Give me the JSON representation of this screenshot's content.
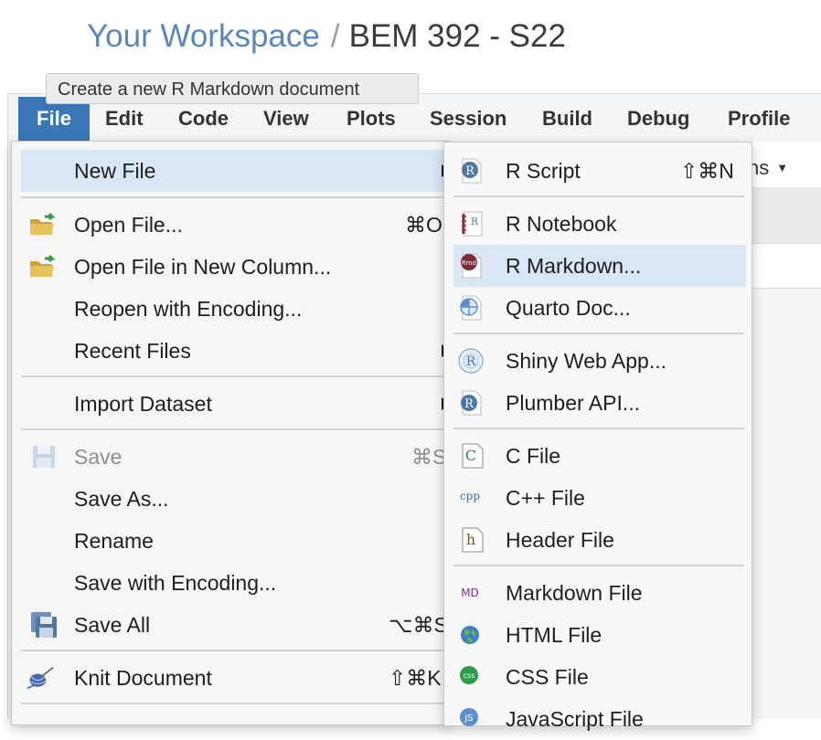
{
  "header": {
    "workspace": "Your Workspace",
    "separator": "/",
    "project": "BEM 392 - S22"
  },
  "tooltip": "Create a new R Markdown document",
  "menubar": {
    "items": [
      "File",
      "Edit",
      "Code",
      "View",
      "Plots",
      "Session",
      "Build",
      "Debug",
      "Profile"
    ],
    "active": "File"
  },
  "toolbar": {
    "addins_partial": "ns"
  },
  "file_menu": {
    "items": [
      {
        "label": "New File",
        "submenu": true,
        "highlighted": true
      },
      {
        "label": "Open File...",
        "shortcut": "⌘O",
        "icon": "open-folder-icon"
      },
      {
        "label": "Open File in New Column...",
        "icon": "open-folder-icon"
      },
      {
        "label": "Reopen with Encoding..."
      },
      {
        "label": "Recent Files",
        "submenu": true
      },
      {
        "label": "Import Dataset",
        "submenu": true
      },
      {
        "label": "Save",
        "shortcut": "⌘S",
        "disabled": true,
        "icon": "save-icon"
      },
      {
        "label": "Save As..."
      },
      {
        "label": "Rename"
      },
      {
        "label": "Save with Encoding..."
      },
      {
        "label": "Save All",
        "shortcut": "⌥⌘S",
        "icon": "save-all-icon"
      },
      {
        "label": "Knit Document",
        "shortcut": "⇧⌘K",
        "icon": "knit-icon"
      }
    ]
  },
  "new_file_menu": {
    "items": [
      {
        "label": "R Script",
        "shortcut": "⇧⌘N",
        "icon": "r-script-icon",
        "icon_text": "R"
      },
      {
        "label": "R Notebook",
        "icon": "r-notebook-icon",
        "icon_text": "R"
      },
      {
        "label": "R Markdown...",
        "icon": "r-markdown-icon",
        "icon_text": "Rmd",
        "highlighted": true
      },
      {
        "label": "Quarto Doc...",
        "icon": "quarto-icon"
      },
      {
        "label": "Shiny Web App...",
        "icon": "shiny-icon",
        "icon_text": "R"
      },
      {
        "label": "Plumber API...",
        "icon": "plumber-icon",
        "icon_text": "R"
      },
      {
        "label": "C File",
        "icon": "c-file-icon",
        "icon_text": "C"
      },
      {
        "label": "C++ File",
        "icon": "cpp-file-icon",
        "icon_text": "cpp"
      },
      {
        "label": "Header File",
        "icon": "header-file-icon",
        "icon_text": "h"
      },
      {
        "label": "Markdown File",
        "icon": "markdown-file-icon",
        "icon_text": "MD"
      },
      {
        "label": "HTML File",
        "icon": "html-file-icon"
      },
      {
        "label": "CSS File",
        "icon": "css-file-icon",
        "icon_text": "css"
      },
      {
        "label": "JavaScript File",
        "icon": "javascript-file-icon",
        "icon_text": "JS"
      }
    ]
  },
  "colors": {
    "accent": "#3a76b6",
    "highlight": "#d9e6f4",
    "workspace_link": "#5b87b8",
    "rmd_icon": "#7a2b3c",
    "r_icon": "#5076a8",
    "md_icon": "#7b2d8b",
    "css_icon": "#2e9a4a"
  }
}
